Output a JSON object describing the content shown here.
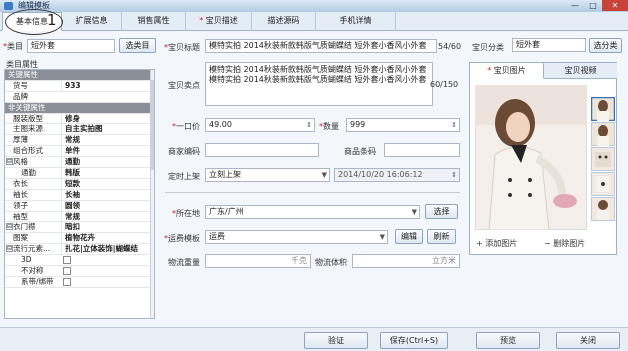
{
  "window": {
    "title": "编辑模板",
    "min": "—",
    "max": "□",
    "close": "✕"
  },
  "tabs": [
    {
      "label": "基本信息",
      "required": false
    },
    {
      "label": "扩展信息",
      "required": false
    },
    {
      "label": "销售属性",
      "required": false
    },
    {
      "label": "宝贝描述",
      "required": true
    },
    {
      "label": "描述源码",
      "required": false
    },
    {
      "label": "手机详情",
      "required": false
    }
  ],
  "annotation": {
    "number": "1"
  },
  "category": {
    "label": "类目",
    "value": "短外套",
    "button": "选类目"
  },
  "properties": {
    "heading": "类目属性",
    "rows": [
      {
        "type": "section",
        "key": "关键属性"
      },
      {
        "key": "货号",
        "value": "933"
      },
      {
        "key": "品牌",
        "value": ""
      },
      {
        "type": "section",
        "key": "非关键属性"
      },
      {
        "key": "服装版型",
        "value": "修身"
      },
      {
        "key": "主图来源",
        "value": "自主实拍图"
      },
      {
        "key": "厚薄",
        "value": "常规"
      },
      {
        "key": "组合形式",
        "value": "单件"
      },
      {
        "key": "风格",
        "value": "通勤",
        "expander": "⊟"
      },
      {
        "key": "通勤",
        "value": "韩版",
        "indent": true
      },
      {
        "key": "衣长",
        "value": "短款"
      },
      {
        "key": "袖长",
        "value": "长袖"
      },
      {
        "key": "领子",
        "value": "圆领"
      },
      {
        "key": "袖型",
        "value": "常规"
      },
      {
        "key": "衣门襟",
        "value": "暗扣",
        "expander": "⊟"
      },
      {
        "key": "图案",
        "value": "植物花卉"
      },
      {
        "key": "流行元素...",
        "value": "扎花|立体装饰|蝴蝶结",
        "expander": "⊟"
      },
      {
        "key": "3D",
        "value": "",
        "checkbox": true,
        "indent": true
      },
      {
        "key": "不对称",
        "value": "",
        "checkbox": true,
        "indent": true
      },
      {
        "key": "系带/绑带",
        "value": "",
        "checkbox": true,
        "indent": true
      }
    ]
  },
  "form": {
    "title_label": "宝贝标题",
    "title_value": "模特实拍 2014秋装新款韩版气质蝴蝶结 短外套小香风小外套",
    "title_count": "54/60",
    "shop_category_label": "宝贝分类",
    "shop_category_value": "短外套",
    "shop_category_button": "选分类",
    "selling_label": "宝贝卖点",
    "selling_value": "模特实拍 2014秋装新款韩版气质蝴蝶结 短外套小香风小外套模特实拍 2014秋装新款韩版气质蝴蝶结 短外套小香风小外套",
    "selling_count": "60/150",
    "price_label": "一口价",
    "price_value": "49.00",
    "qty_label": "数量",
    "qty_value": "999",
    "merchant_code_label": "商家编码",
    "barcode_label": "商品条码",
    "schedule_label": "定时上架",
    "schedule_value": "立刻上架",
    "schedule_time": "2014/10/20 16:06:12",
    "location_label": "所在地",
    "location_value": "广东/广州",
    "location_button": "选择",
    "freight_label": "运费模板",
    "freight_value": "运费",
    "freight_edit": "编辑",
    "freight_refresh": "刷新",
    "weight_label": "物流重量",
    "weight_unit": "千克",
    "volume_label": "物流体积",
    "volume_unit": "立方米"
  },
  "pictures": {
    "tab_images": "宝贝图片",
    "tab_video": "宝贝视频",
    "add": "添加图片",
    "delete": "删除图片",
    "add_symbol": "+",
    "delete_symbol": "−"
  },
  "footer": {
    "verify": "验证",
    "save": "保存(Ctrl+S)",
    "preview": "预览",
    "close": "关闭"
  }
}
